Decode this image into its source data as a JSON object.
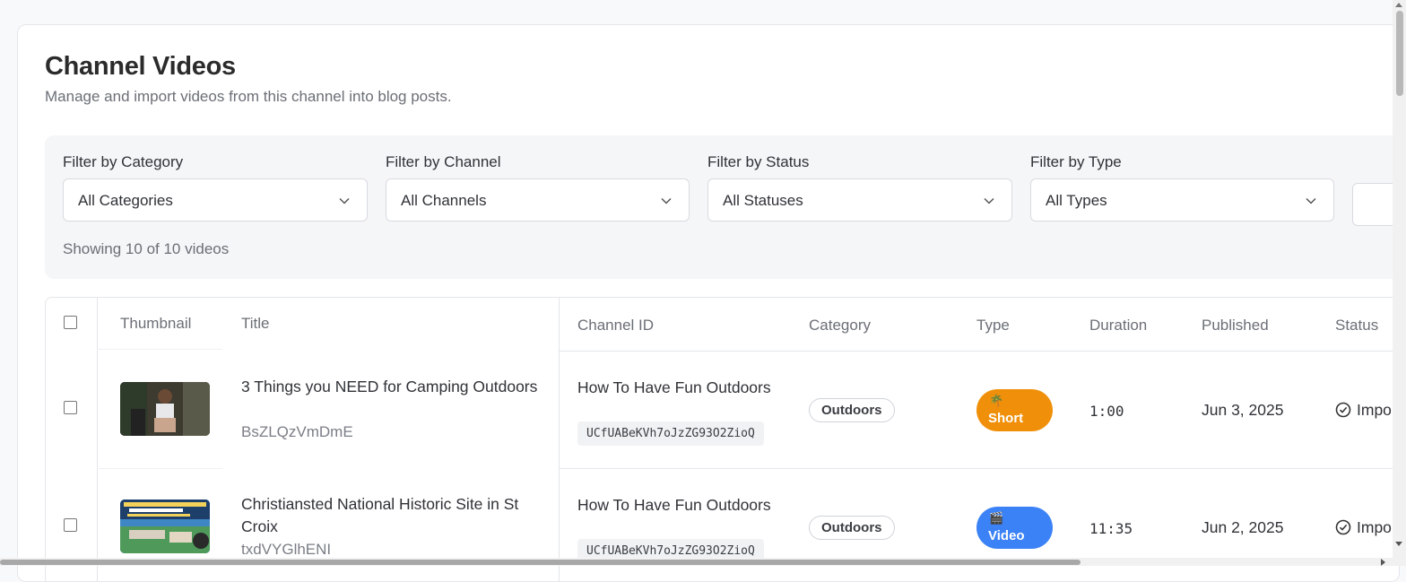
{
  "page": {
    "title": "Channel Videos",
    "subtitle": "Manage and import videos from this channel into blog posts."
  },
  "filters": [
    {
      "label": "Filter by Category",
      "value": "All Categories"
    },
    {
      "label": "Filter by Channel",
      "value": "All Channels"
    },
    {
      "label": "Filter by Status",
      "value": "All Statuses"
    },
    {
      "label": "Filter by Type",
      "value": "All Types"
    }
  ],
  "count_text": "Showing 10 of 10 videos",
  "table": {
    "columns": [
      "Thumbnail",
      "Title",
      "Channel ID",
      "Category",
      "Type",
      "Duration",
      "Published",
      "Status"
    ],
    "rows": [
      {
        "title": "3 Things you NEED for Camping Outdoors",
        "video_id": "BsZLQzVmDmE",
        "channel_name": "How To Have Fun Outdoors",
        "channel_id": "UCfUABeKVh7oJzZG93O2ZioQ",
        "category": "Outdoors",
        "type": "Short",
        "type_emoji": "🌴",
        "type_color": "#f0900a",
        "duration": "1:00",
        "published": "Jun 3, 2025",
        "status": "Impo"
      },
      {
        "title": "Christiansted National Historic Site in St Croix",
        "video_id": "txdVYGlhENI",
        "channel_name": "How To Have Fun Outdoors",
        "channel_id": "UCfUABeKVh7oJzZG93O2ZioQ",
        "category": "Outdoors",
        "type": "Video",
        "type_emoji": "🎬",
        "type_color": "#3b82f6",
        "duration": "11:35",
        "published": "Jun 2, 2025",
        "status": "Impo"
      }
    ]
  },
  "icons": {
    "chevron": "chevron-down-icon",
    "status": "check-circle-icon"
  }
}
